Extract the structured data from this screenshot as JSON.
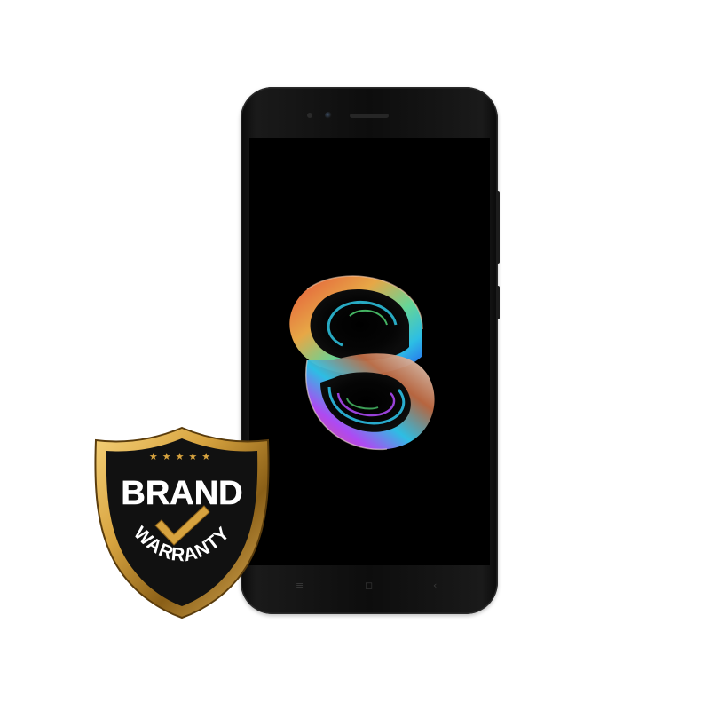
{
  "image": {
    "subject": "smartphone-product-photo",
    "phone": {
      "color": "#0d0d0d",
      "screen_color": "#000000",
      "nav_keys": [
        "≡",
        "◻",
        "‹"
      ]
    },
    "wallpaper": {
      "icon": "swirl-s-logo",
      "colors": [
        "#e8503a",
        "#f5a623",
        "#31d3f2",
        "#2e6bff",
        "#b44cff",
        "#55e07a"
      ]
    },
    "badge": {
      "line1": "BRAND",
      "line2": "WARRANTY",
      "stars": "★★★★★",
      "icon": "checkmark-icon",
      "colors": {
        "gold": "#d7a33f",
        "gold_dark": "#8a5f17",
        "fill": "#111111",
        "text": "#ffffff"
      }
    }
  }
}
